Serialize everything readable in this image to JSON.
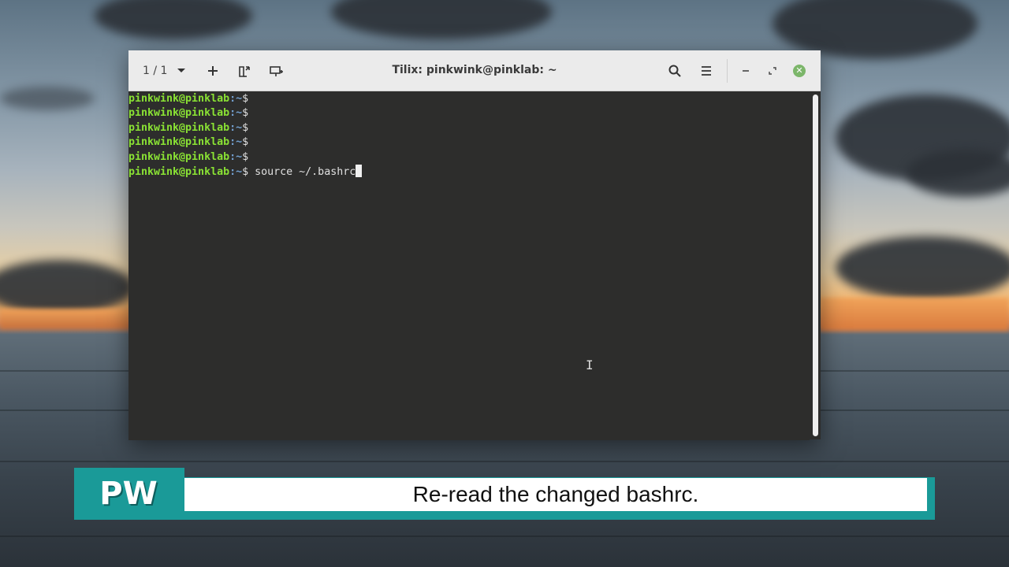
{
  "window": {
    "title": "Tilix: pinkwink@pinklab: ~",
    "session_count": "1 / 1",
    "icons": {
      "session_dropdown": "chevron-down-icon",
      "add": "plus-icon",
      "split_right": "split-right-icon",
      "add_session": "add-session-icon",
      "search": "search-icon",
      "menu": "hamburger-menu-icon",
      "minimize": "minimize-icon",
      "maximize": "maximize-icon",
      "close": "close-icon"
    },
    "colors": {
      "close_button": "#7cb66a",
      "prompt_user": "#8ae234",
      "prompt_path": "#729fcf",
      "terminal_bg": "#2d2d2c"
    }
  },
  "terminal": {
    "lines": [
      {
        "user": "pinkwink@pinklab",
        "path": ":~",
        "sym": "$",
        "cmd": ""
      },
      {
        "user": "pinkwink@pinklab",
        "path": ":~",
        "sym": "$",
        "cmd": ""
      },
      {
        "user": "pinkwink@pinklab",
        "path": ":~",
        "sym": "$",
        "cmd": ""
      },
      {
        "user": "pinkwink@pinklab",
        "path": ":~",
        "sym": "$",
        "cmd": ""
      },
      {
        "user": "pinkwink@pinklab",
        "path": ":~",
        "sym": "$",
        "cmd": ""
      },
      {
        "user": "pinkwink@pinklab",
        "path": ":~",
        "sym": "$",
        "cmd": " source ~/.bashrc"
      }
    ]
  },
  "caption": {
    "badge": "PW",
    "text": "Re-read the changed bashrc.",
    "colors": {
      "banner": "#1a9a98",
      "box": "#ffffff"
    }
  }
}
